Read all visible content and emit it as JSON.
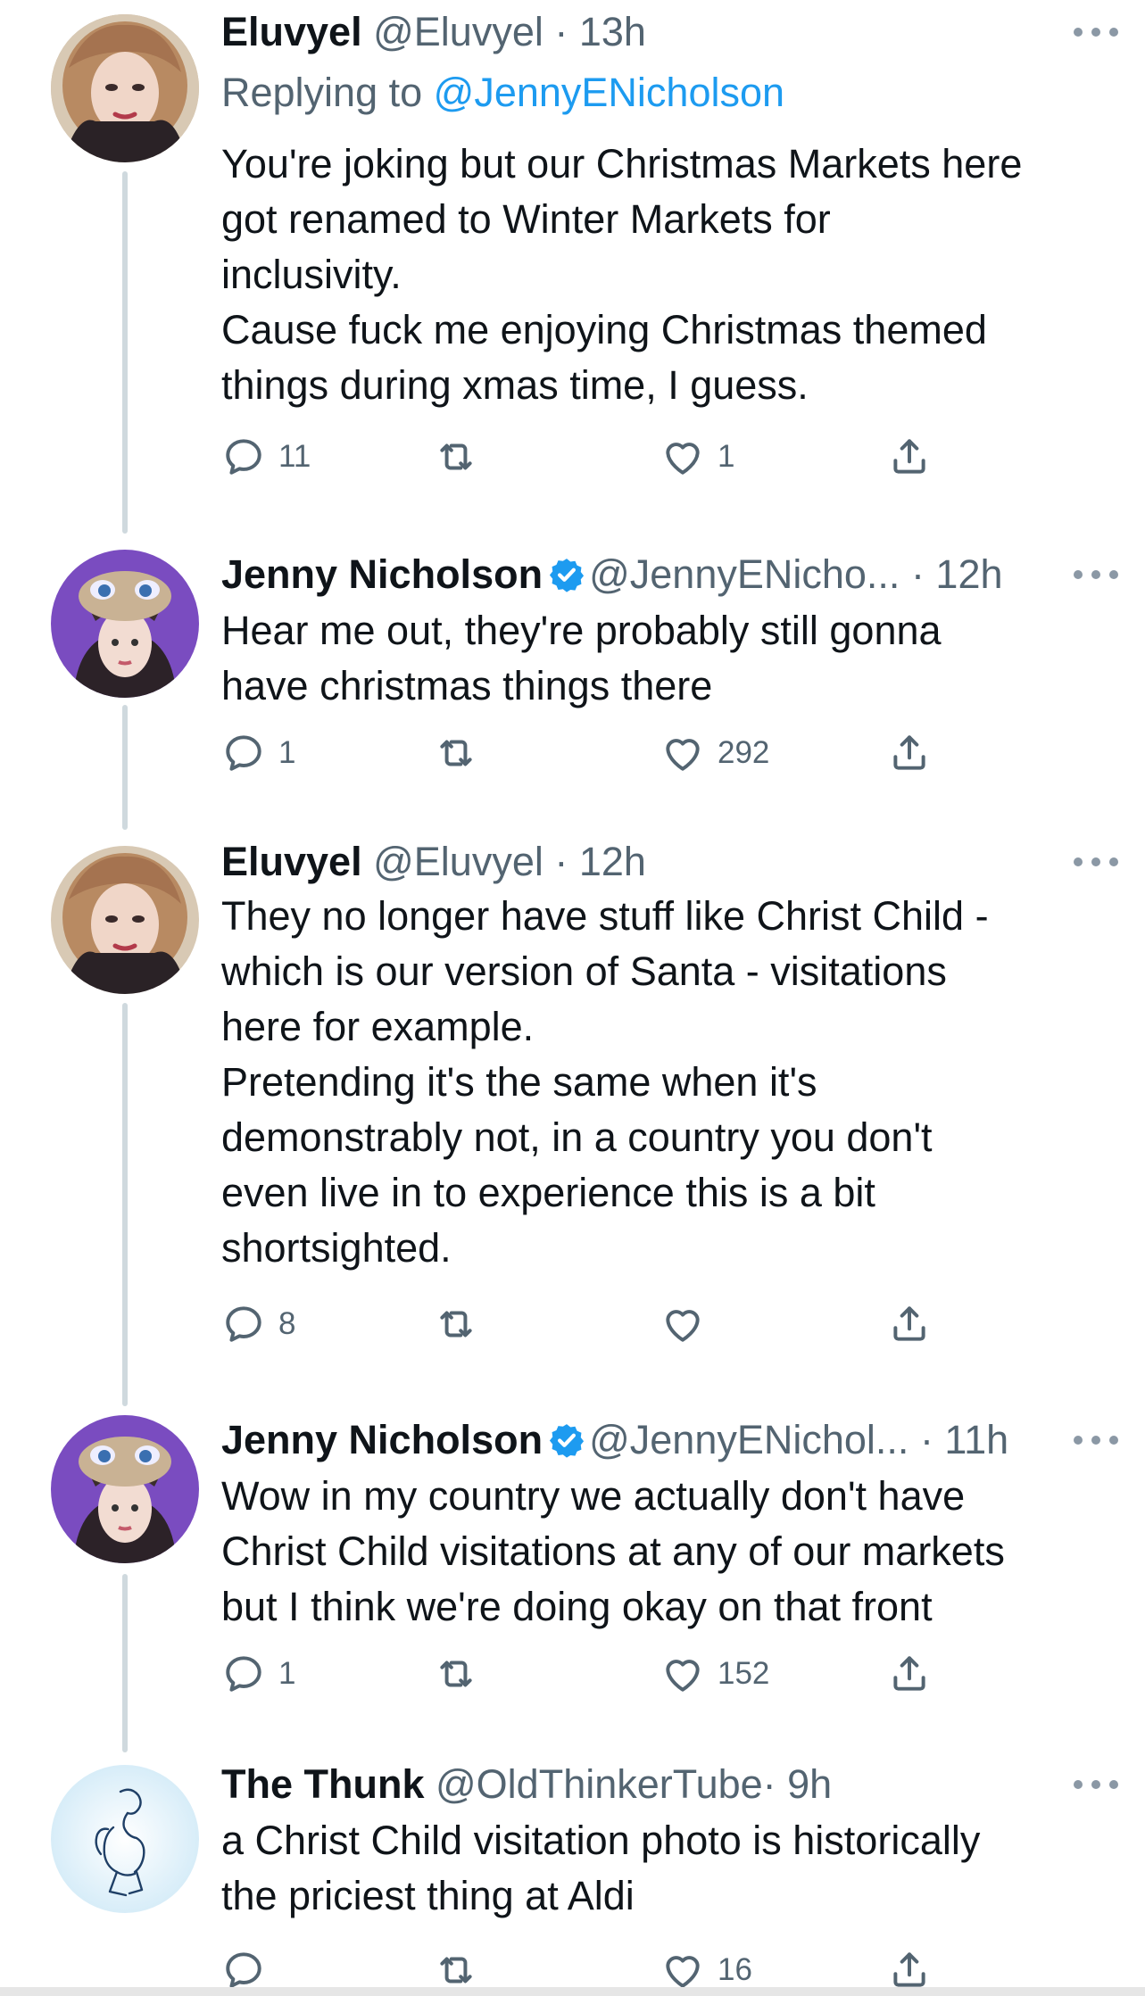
{
  "tweets": [
    {
      "name": "Eluvyel",
      "handle": "@Eluvyel",
      "time": "· 13h",
      "replying_prefix": "Replying to ",
      "replying_handle": "@JennyENicholson",
      "lines": [
        "You're joking but our Christmas Markets here",
        "got renamed to Winter Markets for",
        "inclusivity.",
        "Cause fuck me enjoying Christmas themed",
        "things during xmas time, I guess."
      ],
      "replies": "11",
      "retweets": "",
      "likes": "1"
    },
    {
      "name": "Jenny Nicholson",
      "handle": "@JennyENicho...",
      "time": "· 12h",
      "lines": [
        "Hear me out, they're probably still gonna",
        "have christmas things there"
      ],
      "replies": "1",
      "retweets": "",
      "likes": "292"
    },
    {
      "name": "Eluvyel",
      "handle": "@Eluvyel",
      "time": "· 12h",
      "lines": [
        "They no longer have stuff like Christ Child -",
        "which is our version of Santa - visitations",
        "here for example.",
        "Pretending it's the same when it's",
        "demonstrably not, in a country you don't",
        "even live in to experience this is a bit",
        "shortsighted."
      ],
      "replies": "8",
      "retweets": "",
      "likes": ""
    },
    {
      "name": "Jenny Nicholson",
      "handle": "@JennyENichol...",
      "time": "· 11h",
      "lines": [
        "Wow in my country we actually don't have",
        "Christ Child visitations at any of our markets",
        "but I think we're doing okay on that front"
      ],
      "replies": "1",
      "retweets": "",
      "likes": "152"
    },
    {
      "name": "The Thunk",
      "handle": "@OldThinkerTube",
      "time": "· 9h",
      "lines": [
        "a Christ Child visitation photo is historically",
        "the priciest thing at Aldi"
      ],
      "replies": "",
      "retweets": "",
      "likes": "16"
    }
  ],
  "colors": {
    "link": "#1d9bf0",
    "verified": "#1d9bf0",
    "secondary": "#536471",
    "thread_line": "#cfd9de"
  },
  "icons": [
    "reply-icon",
    "retweet-icon",
    "like-icon",
    "share-icon",
    "more-icon",
    "verified-badge-icon"
  ]
}
